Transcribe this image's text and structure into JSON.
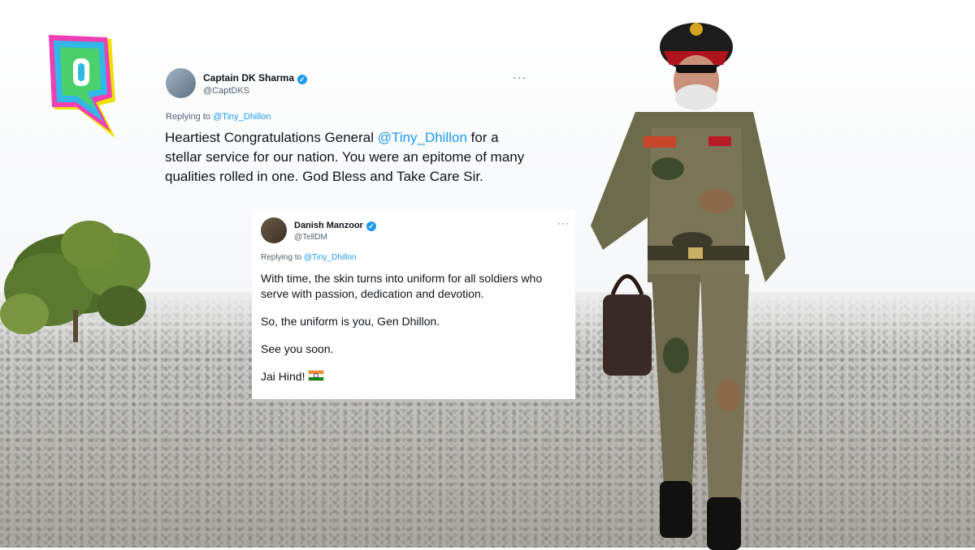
{
  "tweet_main": {
    "name": "Captain DK Sharma",
    "handle": "@CaptDKS",
    "replying_prefix": "Replying to ",
    "replying_to": "@Tiny_Dhillon",
    "more": "···",
    "text_before": "Heartiest Congratulations General ",
    "mention": "@Tiny_Dhillon",
    "text_after": " for a stellar service for our nation. You were an epitome of many qualities rolled in one. God Bless and Take Care Sir."
  },
  "tweet_reply": {
    "name": "Danish Manzoor",
    "handle": "@TellDM",
    "replying_prefix": "Replying to ",
    "replying_to": "@Tiny_Dhillon",
    "more": "···",
    "para1": "With time, the skin turns into uniform for all soldiers who serve with passion, dedication and devotion.",
    "para2": "So, the uniform is you, Gen Dhillon.",
    "para3": "See you soon.",
    "para4": "Jai Hind!",
    "para4_icon": "india-flag-icon"
  },
  "colors": {
    "link": "#1d9bf0",
    "text": "#0f1419",
    "muted": "#536471"
  }
}
